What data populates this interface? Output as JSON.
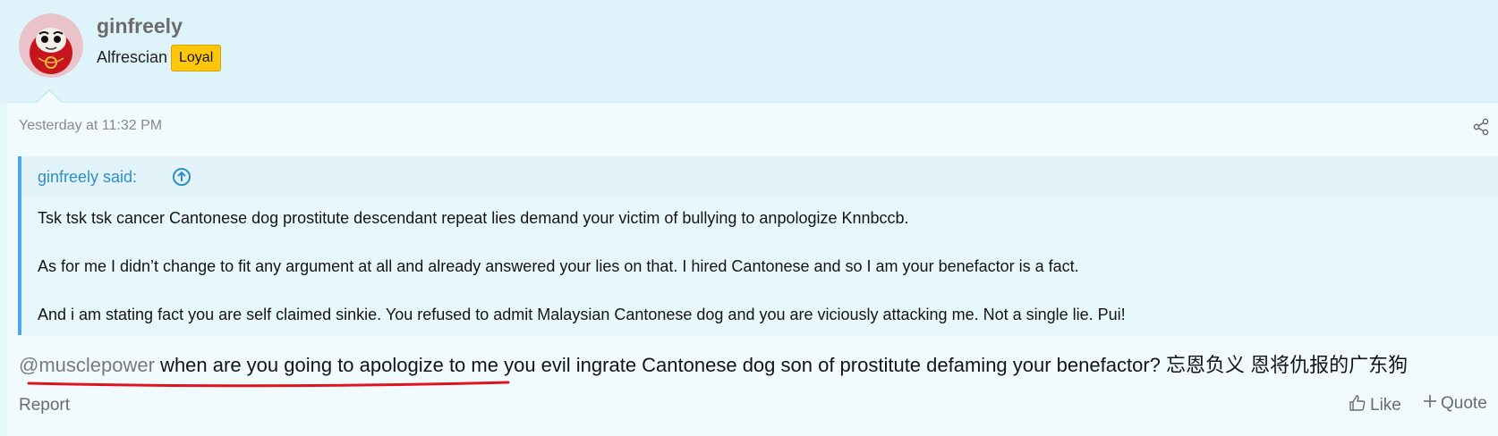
{
  "author": {
    "username": "ginfreely",
    "title": "Alfrescian",
    "badge": "Loyal"
  },
  "post": {
    "timestamp": "Yesterday at 11:32 PM",
    "quote": {
      "author_label": "ginfreely said:",
      "lines": [
        "Tsk tsk tsk cancer Cantonese dog prostitute descendant repeat lies demand your victim of bullying to anpologize Knnbccb.",
        "As for me I didn’t change to fit any argument at all and already answered your lies on that. I hired Cantonese and so I am your benefactor is a fact.",
        "And i am stating fact you are self claimed sinkie. You refused to admit Malaysian Cantonese dog and you are viciously attacking me. Not a single lie. Pui!"
      ]
    },
    "mention": "@musclepower",
    "message": " when are you going to apologize to me you evil ingrate Cantonese dog son of prostitute defaming your benefactor? 忘恩负义 恩将仇报的广东狗"
  },
  "actions": {
    "report": "Report",
    "like": "Like",
    "quote": "Quote"
  },
  "colors": {
    "header_bg": "#dff4fa",
    "post_bg": "#f1fbfd",
    "quote_border": "#47a7eb",
    "link": "#2f8fc6",
    "badge_bg": "#fec70a",
    "underline": "#e0141e"
  },
  "icons": {
    "avatar": "daruma-avatar",
    "share": "share-icon",
    "quote_up": "arrow-up-circle-icon",
    "like": "thumbs-up-icon",
    "quote": "plus-icon"
  }
}
